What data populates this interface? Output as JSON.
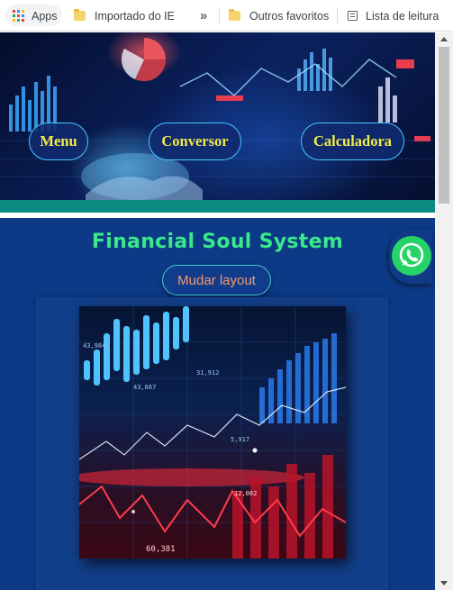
{
  "bookmarks": {
    "apps_label": "Apps",
    "items": [
      {
        "label": "Importado do IE",
        "icon": "folder-icon"
      },
      {
        "label": "»",
        "icon": "chevron-double-right-icon"
      },
      {
        "label": "Outros favoritos",
        "icon": "folder-icon"
      },
      {
        "label": "Lista de leitura",
        "icon": "reading-list-icon"
      }
    ]
  },
  "nav": {
    "menu_label": "Menu",
    "converter_label": "Conversor",
    "calculator_label": "Calculadora"
  },
  "main": {
    "title": "Financial Soul System",
    "layout_button_label": "Mudar layout"
  },
  "chart_image": {
    "numbers": [
      "43,984",
      "31,912",
      "43,667",
      "5,917",
      "12,002",
      "60,381"
    ]
  },
  "colors": {
    "page_bg": "#0d3a86",
    "accent_green": "#39e98a",
    "nav_text": "#f2ea4c",
    "layout_text": "#f39a6a",
    "whatsapp": "#25d366",
    "teal_stripe": "#0b8a7f"
  },
  "floating": {
    "icon": "whatsapp-icon"
  }
}
